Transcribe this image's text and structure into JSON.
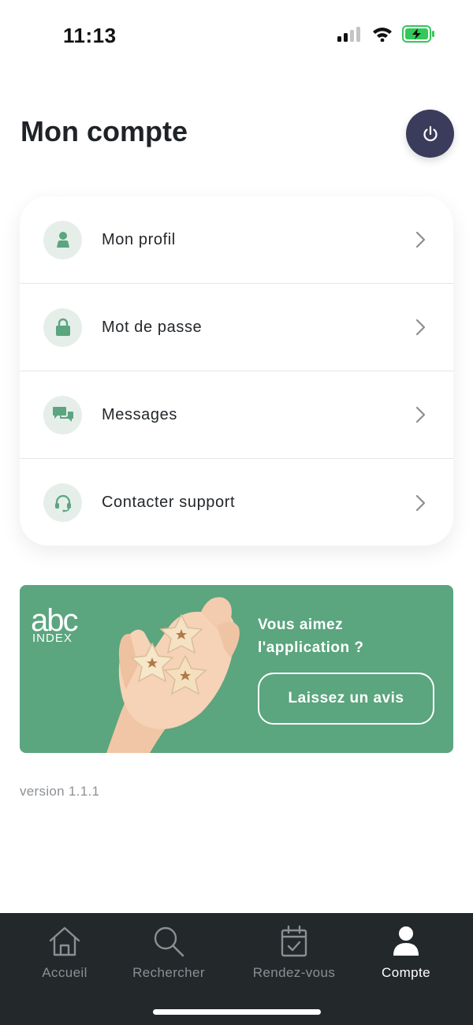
{
  "status_bar": {
    "time": "11:13",
    "icons": [
      "cellular-signal-icon",
      "wifi-icon",
      "battery-charging-icon"
    ]
  },
  "header": {
    "title": "Mon compte",
    "logout_icon": "power-icon"
  },
  "menu": {
    "items": [
      {
        "label": "Mon profil",
        "icon": "user-icon"
      },
      {
        "label": "Mot de passe",
        "icon": "lock-icon"
      },
      {
        "label": "Messages",
        "icon": "chat-icon"
      },
      {
        "label": "Contacter support",
        "icon": "headset-icon"
      }
    ]
  },
  "promo": {
    "logo_main": "abc",
    "logo_sub": "INDEX",
    "question": "Vous aimez l'application ?",
    "button_label": "Laissez un avis"
  },
  "version": "version 1.1.1",
  "tabs": [
    {
      "label": "Accueil",
      "icon": "home-icon",
      "active": false
    },
    {
      "label": "Rechercher",
      "icon": "search-icon",
      "active": false
    },
    {
      "label": "Rendez-vous",
      "icon": "calendar-check-icon",
      "active": false
    },
    {
      "label": "Compte",
      "icon": "person-icon",
      "active": true
    }
  ],
  "colors": {
    "accent_green": "#5ba57f",
    "icon_bg": "#e6eeea",
    "logout_bg": "#3b3c5c",
    "tab_bar_bg": "#23282b",
    "battery_green": "#34c759"
  }
}
